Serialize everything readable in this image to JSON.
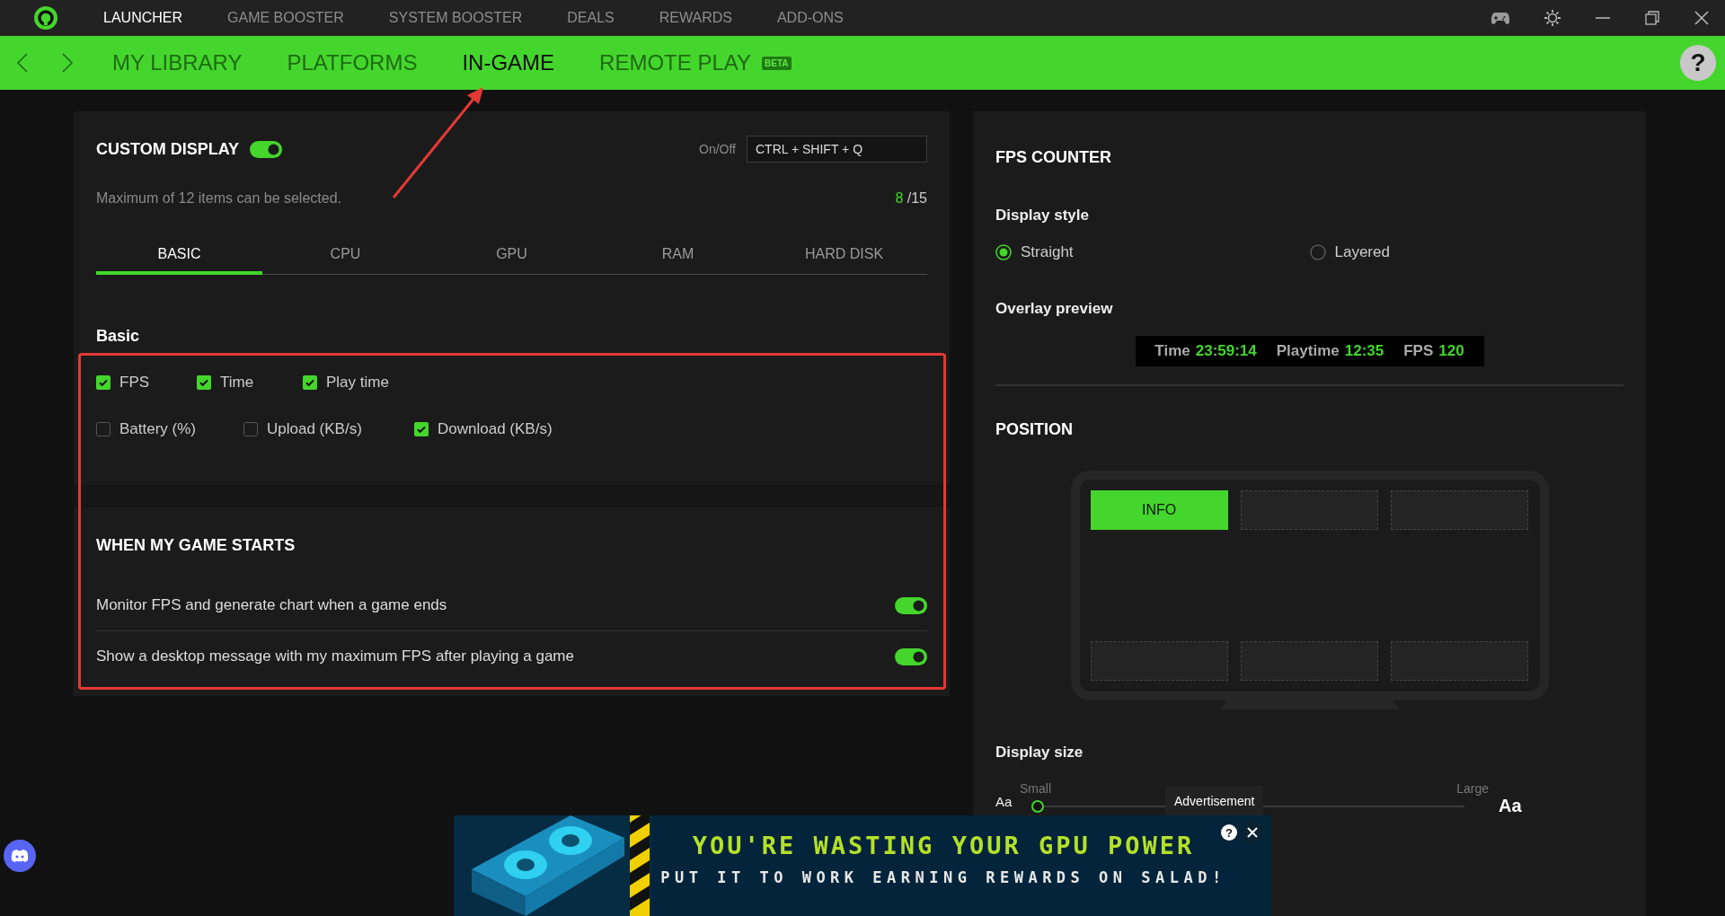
{
  "top_tabs": [
    {
      "label": "LAUNCHER",
      "selected": true
    },
    {
      "label": "GAME BOOSTER",
      "selected": false
    },
    {
      "label": "SYSTEM BOOSTER",
      "selected": false
    },
    {
      "label": "DEALS",
      "selected": false
    },
    {
      "label": "REWARDS",
      "selected": false
    },
    {
      "label": "ADD-ONS",
      "selected": false
    }
  ],
  "nav_tabs": [
    {
      "label": "MY LIBRARY",
      "selected": false
    },
    {
      "label": "PLATFORMS",
      "selected": false
    },
    {
      "label": "IN-GAME",
      "selected": true
    },
    {
      "label": "REMOTE PLAY",
      "selected": false,
      "badge": "BETA"
    }
  ],
  "help": "?",
  "custom_display": {
    "title": "CUSTOM DISPLAY",
    "on": true,
    "shortcut_label": "On/Off",
    "shortcut": "CTRL + SHIFT + Q",
    "note": "Maximum of 12 items can be selected.",
    "count": "8",
    "total": "/15",
    "tabs": [
      {
        "label": "BASIC",
        "selected": true
      },
      {
        "label": "CPU",
        "selected": false
      },
      {
        "label": "GPU",
        "selected": false
      },
      {
        "label": "RAM",
        "selected": false
      },
      {
        "label": "HARD DISK",
        "selected": false
      }
    ],
    "section": "Basic",
    "rows": [
      {
        "items": [
          {
            "label": "FPS",
            "checked": true
          },
          {
            "label": "Time",
            "checked": true
          },
          {
            "label": "Play time",
            "checked": true
          }
        ]
      },
      {
        "items": [
          {
            "label": "Battery (%)",
            "checked": false
          },
          {
            "label": "Upload (KB/s)",
            "checked": false
          },
          {
            "label": "Download (KB/s)",
            "checked": true
          }
        ]
      }
    ]
  },
  "game_start": {
    "title": "WHEN MY GAME STARTS",
    "options": [
      {
        "label": "Monitor FPS and generate chart when a game ends",
        "on": true
      },
      {
        "label": "Show a desktop message with my maximum FPS after playing a game",
        "on": true
      }
    ]
  },
  "fps_counter": {
    "title": "FPS COUNTER",
    "style_label": "Display style",
    "styles": [
      {
        "label": "Straight",
        "selected": true
      },
      {
        "label": "Layered",
        "selected": false
      }
    ],
    "preview_label": "Overlay preview",
    "preview": [
      {
        "label": "Time",
        "value": "23:59:14"
      },
      {
        "label": "Playtime",
        "value": "12:35"
      },
      {
        "label": "FPS",
        "value": "120"
      }
    ],
    "position_title": "POSITION",
    "positions": [
      {
        "label": "INFO",
        "selected": true
      },
      {
        "selected": false
      },
      {
        "selected": false
      },
      {
        "selected": false
      },
      {
        "selected": false
      },
      {
        "selected": false
      }
    ],
    "size_label": "Display size",
    "size_min": "Small",
    "size_max": "Large",
    "sample_small": "Aa",
    "sample_large": "Aa",
    "level": 0
  },
  "ad": {
    "tooltip": "Advertisement",
    "headline": "YOU'RE WASTING YOUR GPU POWER",
    "subline": "PUT IT TO WORK EARNING REWARDS ON SALAD!",
    "help": "?"
  },
  "highlight_box": true,
  "pointer_arrow": true
}
